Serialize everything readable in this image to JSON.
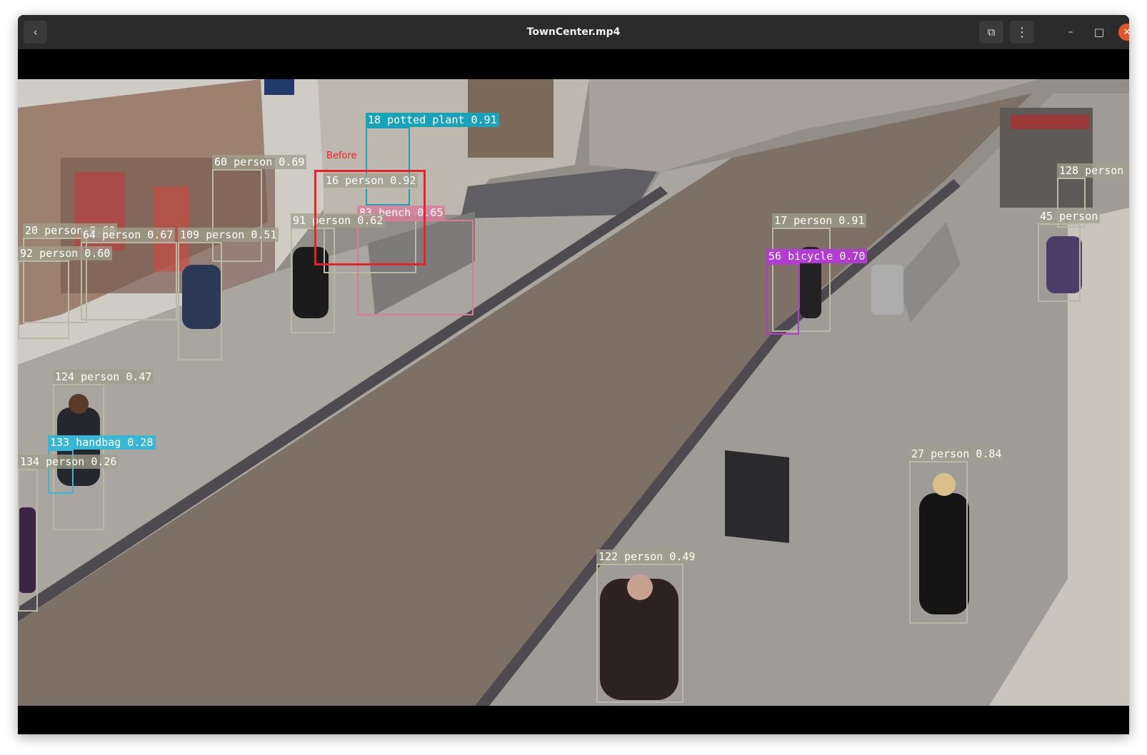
{
  "window": {
    "title": "TownCenter.mp4",
    "buttons": {
      "back": "‹",
      "pip": "⧉",
      "menu": "⋮",
      "minimize": "–",
      "maximize": "□",
      "close": "✕"
    }
  },
  "roi": {
    "label": "Before",
    "color": "#e8222a"
  },
  "detections": [
    {
      "label": "18 potted plant 0.91",
      "color": "#1aa3b8"
    },
    {
      "label": "60 person 0.69",
      "color": "#b9b9a6"
    },
    {
      "label": "16 person 0.92",
      "color": "#b9b9a6"
    },
    {
      "label": "83 bench 0.65",
      "color": "#d87c9a"
    },
    {
      "label": "91 person 0.62",
      "color": "#b9b9a6"
    },
    {
      "label": "20 person 0.60",
      "color": "#b9b9a6"
    },
    {
      "label": "64 person 0.67",
      "color": "#b9b9a6"
    },
    {
      "label": "109 person 0.51",
      "color": "#b9b9a6"
    },
    {
      "label": "92 person 0.60",
      "color": "#b9b9a6"
    },
    {
      "label": "124 person 0.47",
      "color": "#b9b9a6"
    },
    {
      "label": "133 handbag 0.28",
      "color": "#38b6d4"
    },
    {
      "label": "134 person 0.26",
      "color": "#b9b9a6"
    },
    {
      "label": "17 person 0.91",
      "color": "#b9b9a6"
    },
    {
      "label": "56 bicycle 0.70",
      "color": "#b23bd1"
    },
    {
      "label": "128 person",
      "color": "#b9b9a6"
    },
    {
      "label": "45 person",
      "color": "#b9b9a6"
    },
    {
      "label": "27 person 0.84",
      "color": "#b9b9a6"
    },
    {
      "label": "122 person 0.49",
      "color": "#b9b9a6"
    }
  ]
}
